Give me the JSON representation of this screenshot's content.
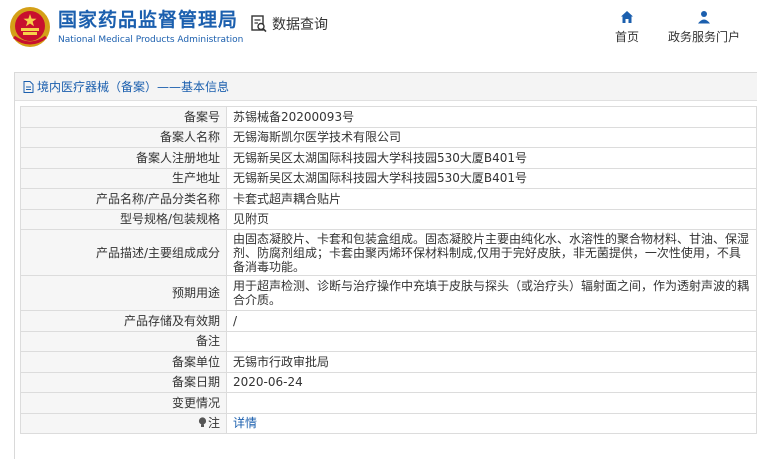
{
  "header": {
    "brand_cn": "国家药品监督管理局",
    "brand_en": "National Medical Products Administration",
    "query_label": "数据查询"
  },
  "nav": {
    "home": "首页",
    "service": "政务服务门户"
  },
  "breadcrumb": "境内医疗器械（备案）——基本信息",
  "rows": [
    {
      "label": "备案号",
      "value": "苏锡械备20200093号"
    },
    {
      "label": "备案人名称",
      "value": "无锡海斯凯尔医学技术有限公司"
    },
    {
      "label": "备案人注册地址",
      "value": "无锡新吴区太湖国际科技园大学科技园530大厦B401号"
    },
    {
      "label": "生产地址",
      "value": "无锡新吴区太湖国际科技园大学科技园530大厦B401号"
    },
    {
      "label": "产品名称/产品分类名称",
      "value": "卡套式超声耦合贴片"
    },
    {
      "label": "型号规格/包装规格",
      "value": "见附页"
    },
    {
      "label": "产品描述/主要组成成分",
      "value": "由固态凝胶片、卡套和包装盒组成。固态凝胶片主要由纯化水、水溶性的聚合物材料、甘油、保湿剂、防腐剂组成；卡套由聚丙烯环保材料制成,仅用于完好皮肤，非无菌提供，一次性使用，不具备消毒功能。"
    },
    {
      "label": "预期用途",
      "value": "用于超声检测、诊断与治疗操作中充填于皮肤与探头（或治疗头）辐射面之间，作为透射声波的耦合介质。"
    },
    {
      "label": "产品存储及有效期",
      "value": "/"
    },
    {
      "label": "备注",
      "value": ""
    },
    {
      "label": "备案单位",
      "value": "无锡市行政审批局"
    },
    {
      "label": "备案日期",
      "value": "2020-06-24"
    },
    {
      "label": "变更情况",
      "value": ""
    }
  ],
  "note": {
    "label": "注",
    "value": "详情"
  }
}
